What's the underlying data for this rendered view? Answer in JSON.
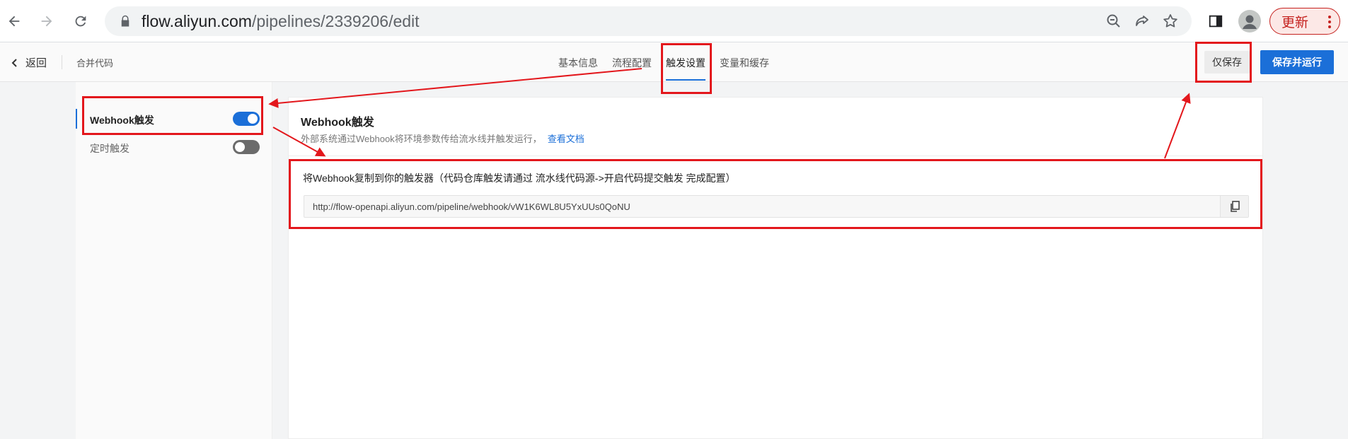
{
  "browser": {
    "url_host": "flow.aliyun.com",
    "url_path": "/pipelines/2339206/edit",
    "update_label": "更新",
    "icons": [
      "back-arrow-icon",
      "forward-arrow-icon",
      "reload-icon",
      "lock-icon",
      "zoom-out-icon",
      "share-icon",
      "star-icon",
      "side-panel-icon",
      "profile-icon",
      "kebab-menu-icon"
    ]
  },
  "header": {
    "back_label": "返回",
    "pipeline_name": "合并代码",
    "tabs": [
      {
        "label": "基本信息",
        "active": false
      },
      {
        "label": "流程配置",
        "active": false
      },
      {
        "label": "触发设置",
        "active": true
      },
      {
        "label": "变量和缓存",
        "active": false
      }
    ],
    "save_only_label": "仅保存",
    "save_and_run_label": "保存并运行"
  },
  "triggers": [
    {
      "label": "Webhook触发",
      "enabled": true,
      "active": true
    },
    {
      "label": "定时触发",
      "enabled": false,
      "active": false
    }
  ],
  "webhook": {
    "title": "Webhook触发",
    "description": "外部系统通过Webhook将环境参数传给流水线并触发运行，",
    "doc_link": "查看文档",
    "copy_instruction": "将Webhook复制到你的触发器（代码仓库触发请通过 流水线代码源->开启代码提交触发 完成配置）",
    "url": "http://flow-openapi.aliyun.com/pipeline/webhook/vW1K6WL8U5YxUUs0QoNU"
  },
  "colors": {
    "accent": "#1b6fd8",
    "annotation": "#e3171c"
  }
}
